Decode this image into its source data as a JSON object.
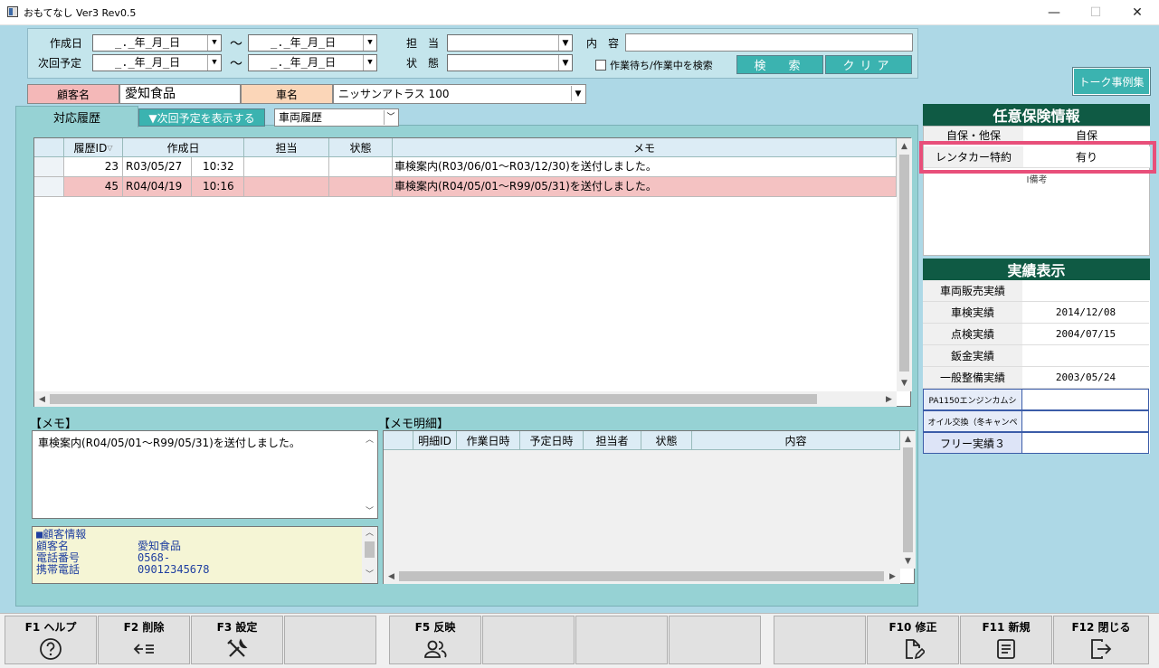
{
  "window": {
    "title": "おもてなし Ver3 Rev0.5",
    "minimize": "—",
    "maximize": "☐",
    "close": "✕"
  },
  "search": {
    "created_label": "作成日",
    "next_label": "次回予定",
    "date_placeholder": "_._年_月_日",
    "tilde": "〜",
    "staff_label": "担　当",
    "status_label": "状　態",
    "content_label": "内　容",
    "content_value": "",
    "checkbox_label": "作業待ち/作業中を検索",
    "search_button": "検　索",
    "clear_button": "クリア"
  },
  "talk_button": "トーク事例集",
  "customer": {
    "name_label": "顧客名",
    "name_value": "愛知食品",
    "car_label": "車名",
    "car_value": "ニッサンアトラス 100"
  },
  "tabs": {
    "history_tab": "対応履歴",
    "next_button": "▼次回予定を表示する",
    "vehicle_history": "車両履歴"
  },
  "history_grid": {
    "headers": [
      "履歴ID",
      "作成日",
      "担当",
      "状態",
      "メモ"
    ],
    "rows": [
      {
        "id": "23",
        "date": "R03/05/27",
        "time": "10:32",
        "staff": "",
        "status": "",
        "memo": "車検案内(R03/06/01〜R03/12/30)を送付しました。"
      },
      {
        "id": "45",
        "date": "R04/04/19",
        "time": "10:16",
        "staff": "",
        "status": "",
        "memo": "車検案内(R04/05/01〜R99/05/31)を送付しました。"
      }
    ]
  },
  "memo": {
    "title": "【メモ】",
    "text": "車検案内(R04/05/01〜R99/05/31)を送付しました。"
  },
  "customer_info": {
    "heading": "■顧客情報",
    "lines": [
      {
        "label": "顧客名",
        "value": "愛知食品"
      },
      {
        "label": "電話番号",
        "value": "0568-"
      },
      {
        "label": "携帯電話",
        "value": "09012345678"
      }
    ]
  },
  "memo_detail": {
    "title": "【メモ明細】",
    "headers": [
      "明細ID",
      "作業日時",
      "予定日時",
      "担当者",
      "状態",
      "内容"
    ]
  },
  "insurance": {
    "title": "任意保険情報",
    "rows": [
      {
        "label": "自保・他保",
        "value": "自保"
      },
      {
        "label": "レンタカー特約",
        "value": "有り"
      }
    ],
    "extra": "I備考"
  },
  "results": {
    "title": "実績表示",
    "rows": [
      {
        "label": "車両販売実績",
        "value": ""
      },
      {
        "label": "車検実績",
        "value": "2014/12/08"
      },
      {
        "label": "点検実績",
        "value": "2004/07/15"
      },
      {
        "label": "鈑金実績",
        "value": ""
      },
      {
        "label": "一般整備実績",
        "value": "2003/05/24"
      },
      {
        "label": "PA1150エンジンカムシ",
        "value": ""
      },
      {
        "label": "オイル交換（冬キャンペ",
        "value": ""
      },
      {
        "label": "フリー実績３",
        "value": ""
      }
    ]
  },
  "fkeys": {
    "f1": "F1 ヘルプ",
    "f2": "F2 削除",
    "f3": "F3 設定",
    "f5": "F5 反映",
    "f10": "F10 修正",
    "f11": "F11 新規",
    "f12": "F12 閉じる"
  }
}
